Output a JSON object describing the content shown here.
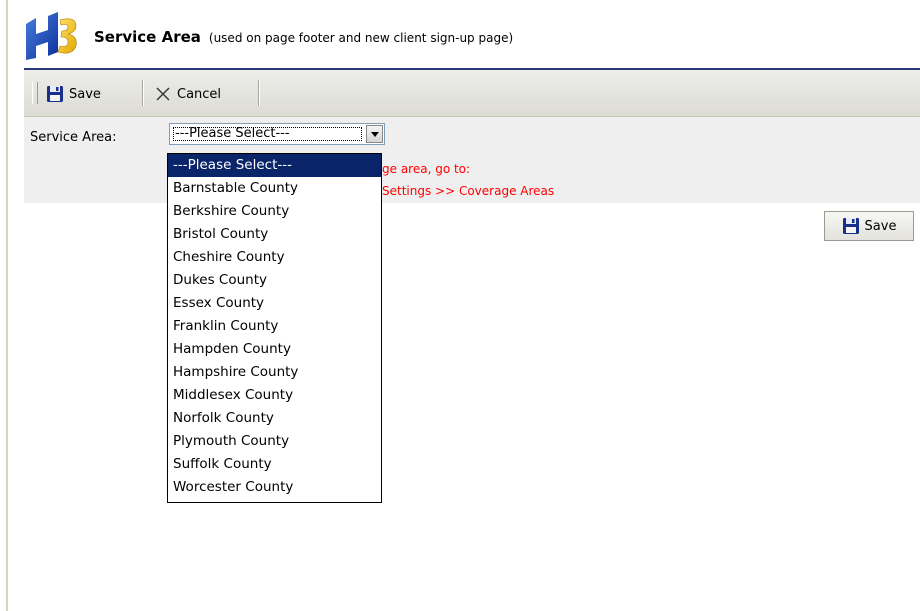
{
  "header": {
    "title": "Service Area",
    "subtitle": "(used on page footer and new client sign-up page)"
  },
  "toolbar": {
    "save_label": "Save",
    "cancel_label": "Cancel"
  },
  "form": {
    "service_area_label": "Service Area:",
    "selected_value": "---Please Select---",
    "hint_line1": "ge area, go to:",
    "hint_line2": "Settings >> Coverage Areas"
  },
  "save_button": {
    "label": "Save"
  },
  "dropdown": {
    "options": [
      "---Please Select---",
      "Barnstable County",
      "Berkshire County",
      "Bristol County",
      "Cheshire County",
      "Dukes County",
      "Essex County",
      "Franklin County",
      "Hampden County",
      "Hampshire County",
      "Middlesex County",
      "Norfolk County",
      "Plymouth County",
      "Suffolk County",
      "Worcester County"
    ],
    "selected_index": 0
  },
  "colors": {
    "header_rule": "#2a3a78",
    "hint_text": "#ff0000",
    "selection": "#0a246a",
    "toolbar": "#e4e3dc",
    "form_bg": "#efefef"
  },
  "icons": {
    "logo": "h3-logo",
    "save": "floppy-disk-icon",
    "cancel": "x-icon",
    "dropdown": "chevron-down-icon"
  }
}
